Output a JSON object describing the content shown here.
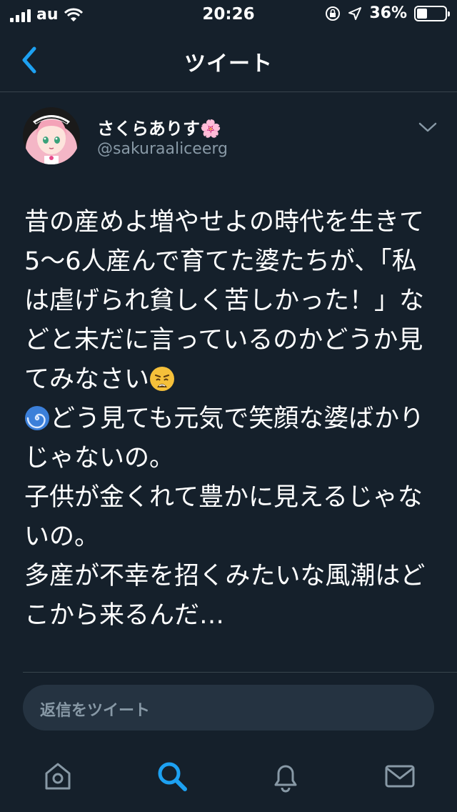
{
  "status_bar": {
    "carrier": "au",
    "time": "20:26",
    "battery_percent": "36%",
    "battery_level": 0.36,
    "icons": [
      "signal-icon",
      "wifi-icon",
      "orientation-lock-icon",
      "location-arrow-icon",
      "battery-icon"
    ]
  },
  "nav": {
    "title": "ツイート",
    "back_icon": "chevron-left-icon"
  },
  "tweet": {
    "user_name": "さくらありす🌸",
    "handle": "@sakuraaliceerg",
    "menu_icon": "chevron-down-icon",
    "text_part1": "昔の産めよ増やせよの時代を生きて5〜6人産んで育てた婆たちが、「私は虐げられ貧しく苦しかった！」などと未だに言っているのかどうか見てみなさい",
    "text_emoji1": "😩",
    "text_emoji2": "🌀",
    "text_part2": "どう見ても元気で笑顔な婆ばかりじゃないの。\n子供が金くれて豊かに見えるじゃないの。\n多産が不幸を招くみたいな風潮はどこから来るんだ…"
  },
  "reply": {
    "placeholder": "返信をツイート"
  },
  "tabbar": {
    "items": [
      "home-icon",
      "search-icon",
      "notifications-icon",
      "messages-icon"
    ],
    "active": "search-icon"
  },
  "colors": {
    "background": "#15202b",
    "accent": "#1da1f2",
    "secondary_text": "#8899a6",
    "divider": "#38444d",
    "reply_bg": "#253341"
  }
}
